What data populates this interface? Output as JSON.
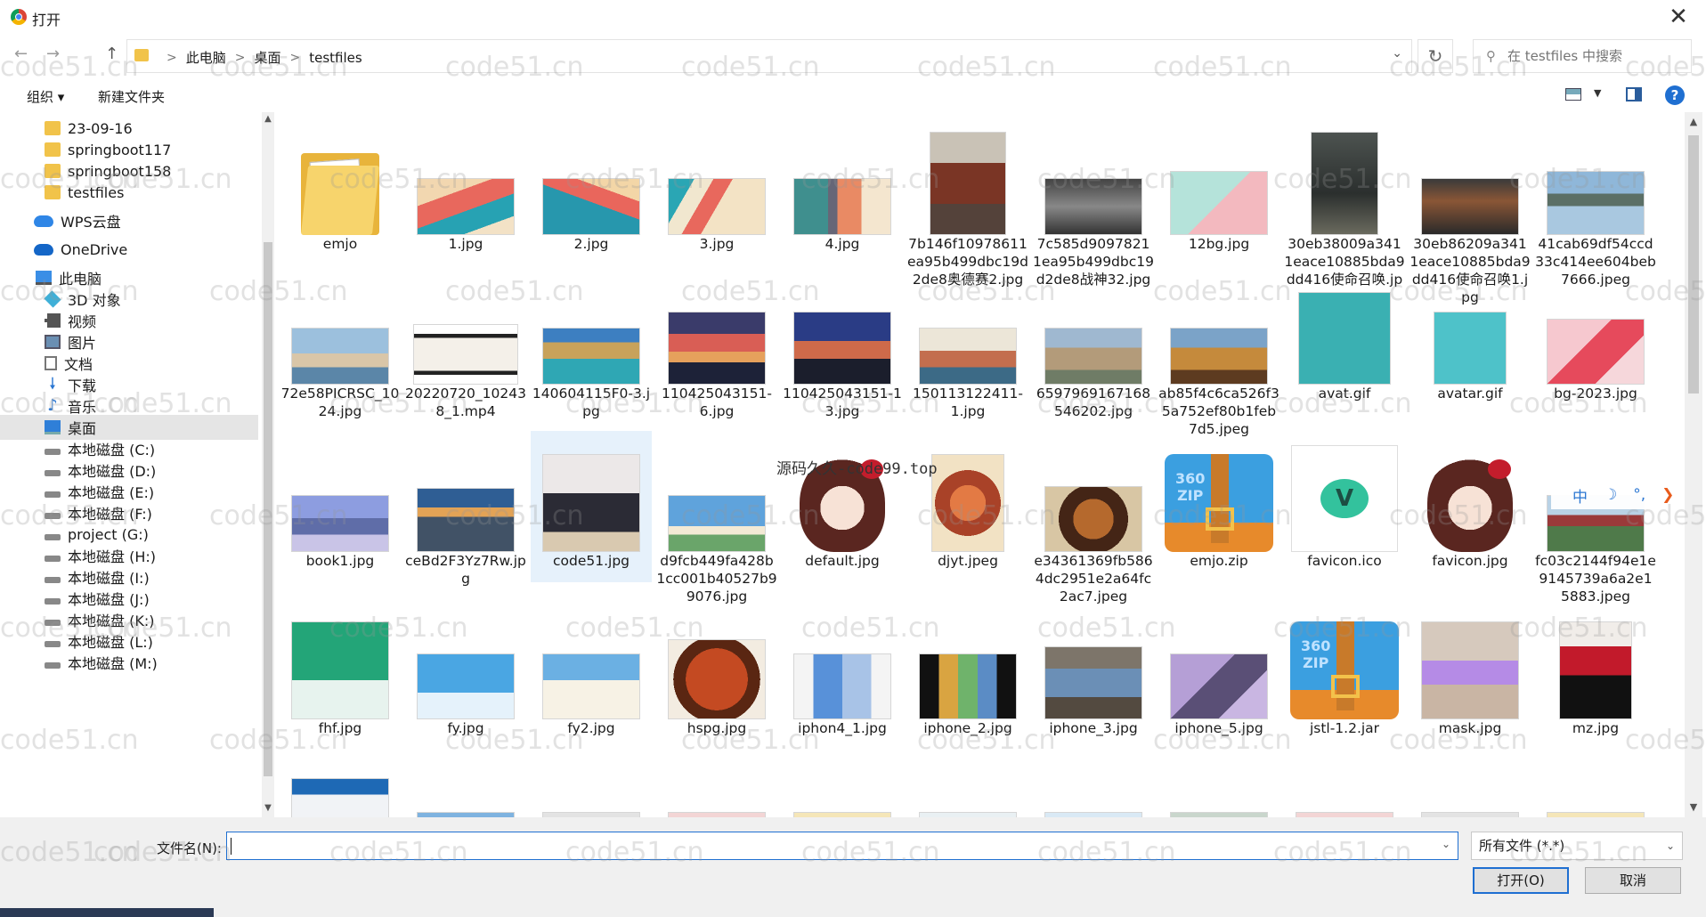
{
  "window": {
    "title": "打开",
    "close_symbol": "✕"
  },
  "nav": {
    "back_symbol": "←",
    "forward_symbol": "→",
    "up_symbol": "↑",
    "breadcrumbs": [
      "此电脑",
      "桌面",
      "testfiles"
    ],
    "breadcrumb_sep": ">",
    "dropdown_symbol": "⌄",
    "refresh_symbol": "↻",
    "search_placeholder": "在 testfiles 中搜索"
  },
  "toolbar": {
    "organize": "组织 ▾",
    "new_folder": "新建文件夹",
    "help": "?"
  },
  "sidebar": {
    "items": [
      {
        "label": "23-09-16",
        "icon": "folder-icon"
      },
      {
        "label": "springboot117",
        "icon": "folder-icon"
      },
      {
        "label": "springboot158",
        "icon": "folder-icon"
      },
      {
        "label": "testfiles",
        "icon": "folder-icon"
      },
      {
        "label": "WPS云盘",
        "icon": "cloud-icon"
      },
      {
        "label": "OneDrive",
        "icon": "onedrive-icon"
      },
      {
        "label": "此电脑",
        "icon": "computer-icon"
      },
      {
        "label": "3D 对象",
        "icon": "3d-objects-icon"
      },
      {
        "label": "视频",
        "icon": "video-icon"
      },
      {
        "label": "图片",
        "icon": "pictures-icon"
      },
      {
        "label": "文档",
        "icon": "documents-icon"
      },
      {
        "label": "下载",
        "icon": "download-icon"
      },
      {
        "label": "音乐",
        "icon": "music-icon"
      },
      {
        "label": "桌面",
        "icon": "desktop-icon"
      },
      {
        "label": "本地磁盘 (C:)",
        "icon": "disk-icon"
      },
      {
        "label": "本地磁盘 (D:)",
        "icon": "disk-icon"
      },
      {
        "label": "本地磁盘 (E:)",
        "icon": "disk-icon"
      },
      {
        "label": "本地磁盘 (F:)",
        "icon": "disk-icon"
      },
      {
        "label": "project (G:)",
        "icon": "disk-icon"
      },
      {
        "label": "本地磁盘 (H:)",
        "icon": "disk-icon"
      },
      {
        "label": "本地磁盘 (I:)",
        "icon": "disk-icon"
      },
      {
        "label": "本地磁盘 (J:)",
        "icon": "disk-icon"
      },
      {
        "label": "本地磁盘 (K:)",
        "icon": "disk-icon"
      },
      {
        "label": "本地磁盘 (L:)",
        "icon": "disk-icon"
      },
      {
        "label": "本地磁盘 (M:)",
        "icon": "disk-icon"
      }
    ],
    "selected": "桌面",
    "scroll_up": "▲",
    "scroll_down": "▼"
  },
  "files": [
    {
      "name": "emjo",
      "kind": "folder"
    },
    {
      "name": "1.jpg",
      "kind": "image"
    },
    {
      "name": "2.jpg",
      "kind": "image"
    },
    {
      "name": "3.jpg",
      "kind": "image"
    },
    {
      "name": "4.jpg",
      "kind": "image"
    },
    {
      "name": "7b146f10978611ea95b499dbc19d2de8奥德赛2.jpg",
      "kind": "image"
    },
    {
      "name": "7c585d90978211ea95b499dbc19d2de8战神32.jpg",
      "kind": "image"
    },
    {
      "name": "12bg.jpg",
      "kind": "image"
    },
    {
      "name": "30eb38009a3411eace10885bda9dd416使命召唤.jpg",
      "kind": "image"
    },
    {
      "name": "30eb86209a3411eace10885bda9dd416使命召唤1.jpg",
      "kind": "image"
    },
    {
      "name": "41cab69df54ccd33c414ee604beb7666.jpeg",
      "kind": "image"
    },
    {
      "name": "72e58PICRSC_1024.jpg",
      "kind": "image"
    },
    {
      "name": "20220720_102438_1.mp4",
      "kind": "video"
    },
    {
      "name": "140604115F0-3.jpg",
      "kind": "image"
    },
    {
      "name": "110425043151-6.jpg",
      "kind": "image"
    },
    {
      "name": "110425043151-13.jpg",
      "kind": "image"
    },
    {
      "name": "150113122411-1.jpg",
      "kind": "image"
    },
    {
      "name": "6597969167168546202.jpg",
      "kind": "image"
    },
    {
      "name": "ab85f4c6ca526f35a752ef80b1feb7d5.jpeg",
      "kind": "image"
    },
    {
      "name": "avat.gif",
      "kind": "image"
    },
    {
      "name": "avatar.gif",
      "kind": "image"
    },
    {
      "name": "bg-2023.jpg",
      "kind": "image"
    },
    {
      "name": "book1.jpg",
      "kind": "image"
    },
    {
      "name": "ceBd2F3Yz7Rw.jpg",
      "kind": "image"
    },
    {
      "name": "code51.jpg",
      "kind": "image"
    },
    {
      "name": "d9fcb449fa428b1cc001b40527b99076.jpg",
      "kind": "image"
    },
    {
      "name": "default.jpg",
      "kind": "image"
    },
    {
      "name": "djyt.jpeg",
      "kind": "image"
    },
    {
      "name": "e34361369fb5864dc2951e2a64fc2ac7.jpeg",
      "kind": "image"
    },
    {
      "name": "emjo.zip",
      "kind": "zip"
    },
    {
      "name": "favicon.ico",
      "kind": "icon"
    },
    {
      "name": "favicon.jpg",
      "kind": "image"
    },
    {
      "name": "fc03c2144f94e1e9145739a6a2e15883.jpeg",
      "kind": "image"
    },
    {
      "name": "fhf.jpg",
      "kind": "image"
    },
    {
      "name": "fy.jpg",
      "kind": "image"
    },
    {
      "name": "fy2.jpg",
      "kind": "image"
    },
    {
      "name": "hspg.jpg",
      "kind": "image"
    },
    {
      "name": "iphon4_1.jpg",
      "kind": "image"
    },
    {
      "name": "iphone_2.jpg",
      "kind": "image"
    },
    {
      "name": "iphone_3.jpg",
      "kind": "image"
    },
    {
      "name": "iphone_5.jpg",
      "kind": "image"
    },
    {
      "name": "jstl-1.2.jar",
      "kind": "zip"
    },
    {
      "name": "mask.jpg",
      "kind": "image"
    },
    {
      "name": "mz.jpg",
      "kind": "image"
    }
  ],
  "zip_brand_text": "360\nZIP",
  "favicon_letter": "V",
  "overlay_text": "源码久久-code99.top",
  "ime": {
    "chinese": "中",
    "moon": "☽",
    "dots": "°,",
    "arrow": "❯"
  },
  "footer": {
    "filename_label": "文件名(N):",
    "filename_value": "",
    "filetype_value": "所有文件 (*.*)",
    "open_button": "打开(O)",
    "cancel_button": "取消",
    "dropdown_symbol": "⌄"
  },
  "watermark": "code51.cn",
  "colors": {
    "accent": "#1f6fd1",
    "selected_bg": "#e5e5e5",
    "hover_bg": "#e6f1fb",
    "folder": "#f1c34a"
  }
}
